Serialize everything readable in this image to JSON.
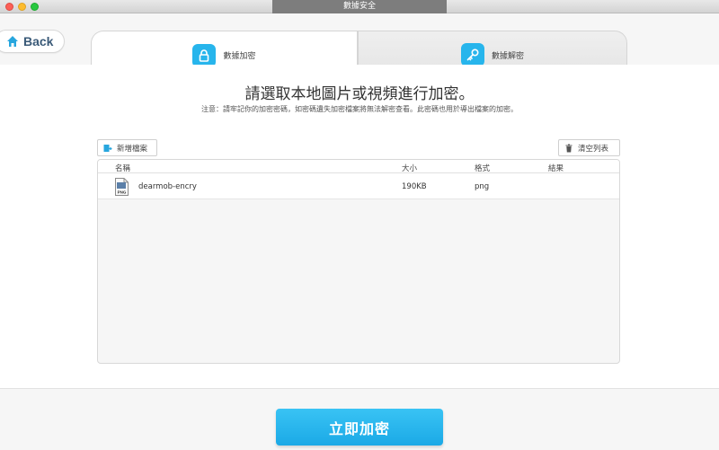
{
  "window": {
    "title": "數據安全"
  },
  "nav": {
    "back_label": "Back"
  },
  "tabs": [
    {
      "label": "數據加密",
      "icon": "lock-icon",
      "active": true
    },
    {
      "label": "數據解密",
      "icon": "key-icon",
      "active": false
    }
  ],
  "main": {
    "headline": "請選取本地圖片或視頻進行加密。",
    "note": "注意：請牢記你的加密密碼，如密碼遺失加密檔案將無法解密查看。此密碼也用於導出檔案的加密。"
  },
  "toolbar": {
    "add_label": "新增檔案",
    "clear_label": "清空列表"
  },
  "table": {
    "columns": [
      "名稱",
      "大小",
      "格式",
      "結果"
    ],
    "rows": [
      {
        "icon": "png-file-icon",
        "icon_text": "PNG",
        "name": "dearmob-encry",
        "size": "190KB",
        "format": "png",
        "result": ""
      }
    ]
  },
  "footer": {
    "encrypt_label": "立即加密"
  },
  "colors": {
    "accent": "#27b5ec",
    "button": "#1ba9e6",
    "title_bar_label": "#7d7d7d"
  }
}
